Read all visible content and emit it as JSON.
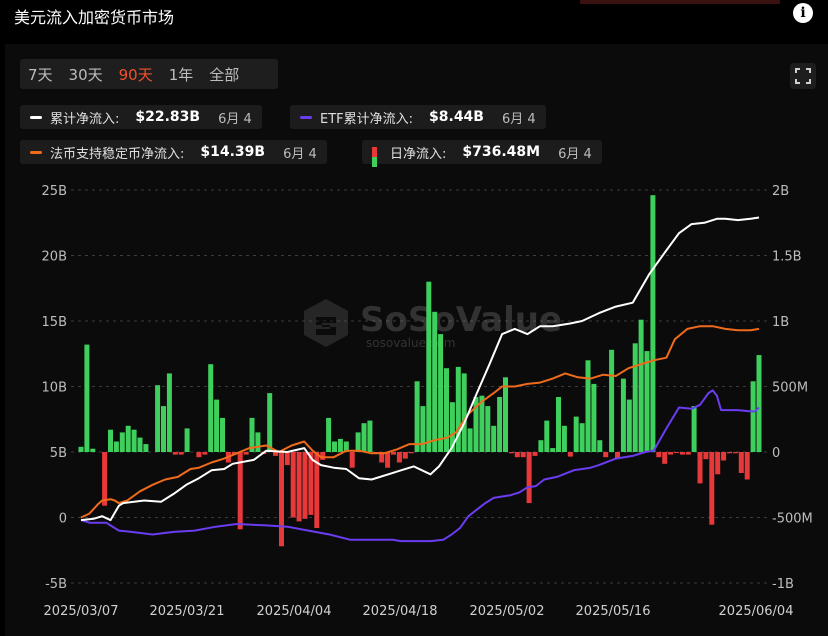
{
  "header": {
    "title": "美元流入加密货币市场",
    "info_icon": "i"
  },
  "tabs": [
    {
      "label": "7天",
      "active": false
    },
    {
      "label": "30天",
      "active": false
    },
    {
      "label": "90天",
      "active": true
    },
    {
      "label": "1年",
      "active": false
    },
    {
      "label": "全部",
      "active": false
    }
  ],
  "legend": [
    {
      "name": "累计净流入:",
      "value": "$22.83B",
      "date": "6月 4",
      "color": "#ffffff",
      "kind": "line"
    },
    {
      "name": "ETF累计净流入:",
      "value": "$8.44B",
      "date": "6月 4",
      "color": "#6a3df0",
      "kind": "line"
    },
    {
      "name": "法币支持稳定币净流入:",
      "value": "$14.39B",
      "date": "6月 4",
      "color": "#f06a1c",
      "kind": "line"
    },
    {
      "name": "日净流入:",
      "value": "$736.48M",
      "date": "6月 4",
      "color_pos": "#3fcf5c",
      "color_neg": "#e8393a",
      "kind": "bar"
    }
  ],
  "watermark": {
    "brand": "SoSoValue",
    "url": "sosovalue.com"
  },
  "colors": {
    "white": "#ffffff",
    "etf": "#6a3df0",
    "stable": "#f06a1c",
    "pos": "#3fcf5c",
    "neg": "#e8393a",
    "grid": "#3c3c3c"
  },
  "chart_data": {
    "type": "bar",
    "title": "美元流入加密货币市场",
    "x_ticks": [
      "2025/03/07",
      "2025/03/21",
      "2025/04/04",
      "2025/04/18",
      "2025/05/02",
      "2025/05/16",
      "2025/06/04"
    ],
    "y_left": {
      "ticks": [
        "-5B",
        "0",
        "5B",
        "10B",
        "15B",
        "20B",
        "25B"
      ],
      "range": [
        -5,
        25
      ],
      "unit": "B"
    },
    "y_right": {
      "ticks": [
        "-1B",
        "-500M",
        "0",
        "500M",
        "1B",
        "1.5B",
        "2B"
      ],
      "range": [
        -1000,
        2000
      ],
      "unit": "M"
    },
    "grid": true,
    "series": [
      {
        "name": "日净流入",
        "axis": "right",
        "type": "bar",
        "values": [
          40,
          820,
          25,
          0,
          -410,
          170,
          80,
          150,
          200,
          170,
          110,
          60,
          0,
          510,
          350,
          600,
          -20,
          -20,
          180,
          0,
          -40,
          -20,
          670,
          400,
          260,
          -80,
          -20,
          -590,
          -20,
          260,
          150,
          -15,
          450,
          -30,
          -720,
          -100,
          -500,
          -530,
          -510,
          -480,
          -580,
          -60,
          260,
          80,
          100,
          80,
          -120,
          150,
          220,
          240,
          -10,
          -80,
          -120,
          -20,
          -80,
          -50,
          -10,
          540,
          350,
          1300,
          1070,
          900,
          640,
          380,
          650,
          600,
          180,
          420,
          430,
          350,
          200,
          420,
          570,
          -10,
          -40,
          -40,
          -390,
          -30,
          90,
          240,
          30,
          420,
          200,
          -35,
          270,
          220,
          700,
          520,
          90,
          -40,
          780,
          -50,
          560,
          400,
          830,
          1010,
          770,
          1960,
          -40,
          -90,
          -20,
          -5,
          -20,
          -20,
          350,
          -240,
          -55,
          -555,
          -170,
          -65,
          -10,
          -10,
          -160,
          -210,
          540,
          740
        ]
      },
      {
        "name": "累计净流入",
        "axis": "left",
        "type": "line",
        "points": [
          [
            0,
            -0.2
          ],
          [
            3,
            -0.1
          ],
          [
            5,
            0.1
          ],
          [
            7,
            -0.2
          ],
          [
            9,
            0.9
          ],
          [
            10,
            1.1
          ],
          [
            15,
            1.3
          ],
          [
            19,
            1.2
          ],
          [
            22,
            1.8
          ],
          [
            25,
            2.5
          ],
          [
            28,
            3.0
          ],
          [
            31,
            3.6
          ],
          [
            34,
            3.7
          ],
          [
            36,
            4.1
          ],
          [
            41,
            4.4
          ],
          [
            44,
            5.1
          ],
          [
            49,
            5.0
          ],
          [
            53,
            5.3
          ],
          [
            55,
            4.4
          ],
          [
            57,
            4.0
          ],
          [
            60,
            3.8
          ],
          [
            63,
            3.7
          ],
          [
            66,
            3.0
          ],
          [
            69,
            2.9
          ],
          [
            73,
            3.3
          ],
          [
            76,
            3.6
          ],
          [
            79,
            3.9
          ],
          [
            83,
            3.3
          ],
          [
            85,
            3.9
          ],
          [
            88,
            5.3
          ],
          [
            91,
            7.2
          ],
          [
            94,
            9.5
          ],
          [
            97,
            11.7
          ],
          [
            100,
            14.0
          ],
          [
            103,
            14.4
          ],
          [
            106,
            14.0
          ],
          [
            109,
            14.6
          ],
          [
            112,
            14.6
          ],
          [
            116,
            14.8
          ],
          [
            119,
            15.0
          ],
          [
            123,
            15.6
          ],
          [
            127,
            16.1
          ],
          [
            131,
            16.4
          ],
          [
            135,
            18.6
          ],
          [
            139,
            20.4
          ],
          [
            142,
            21.7
          ],
          [
            145,
            22.4
          ],
          [
            148,
            22.5
          ],
          [
            151,
            22.8
          ],
          [
            153,
            22.8
          ],
          [
            156,
            22.7
          ],
          [
            159,
            22.8
          ],
          [
            161,
            22.9
          ]
        ]
      },
      {
        "name": "ETF累计净流入",
        "axis": "left",
        "type": "line",
        "points": [
          [
            0,
            -0.2
          ],
          [
            2,
            -0.4
          ],
          [
            6,
            -0.4
          ],
          [
            7,
            -0.6
          ],
          [
            9,
            -1.0
          ],
          [
            12,
            -1.1
          ],
          [
            17,
            -1.3
          ],
          [
            22,
            -1.1
          ],
          [
            27,
            -1.0
          ],
          [
            32,
            -0.7
          ],
          [
            37,
            -0.5
          ],
          [
            44,
            -0.6
          ],
          [
            49,
            -0.7
          ],
          [
            54,
            -1.0
          ],
          [
            59,
            -1.3
          ],
          [
            64,
            -1.7
          ],
          [
            69,
            -1.7
          ],
          [
            74,
            -1.7
          ],
          [
            76,
            -1.8
          ],
          [
            79,
            -1.8
          ],
          [
            83,
            -1.8
          ],
          [
            86,
            -1.7
          ],
          [
            88,
            -1.3
          ],
          [
            90,
            -0.8
          ],
          [
            92,
            0.1
          ],
          [
            94,
            0.6
          ],
          [
            96,
            1.1
          ],
          [
            98,
            1.5
          ],
          [
            100,
            1.6
          ],
          [
            102,
            1.7
          ],
          [
            104,
            1.9
          ],
          [
            106,
            2.3
          ],
          [
            108,
            2.4
          ],
          [
            110,
            2.9
          ],
          [
            113,
            3.1
          ],
          [
            117,
            3.6
          ],
          [
            121,
            3.8
          ],
          [
            123,
            4.0
          ],
          [
            127,
            4.5
          ],
          [
            131,
            4.7
          ],
          [
            134,
            5.0
          ],
          [
            136,
            5.1
          ],
          [
            139,
            6.8
          ],
          [
            142,
            8.4
          ],
          [
            145,
            8.3
          ],
          [
            147,
            8.6
          ],
          [
            149,
            9.5
          ],
          [
            150,
            9.7
          ],
          [
            151,
            9.3
          ],
          [
            152,
            8.2
          ],
          [
            156,
            8.2
          ],
          [
            159,
            8.1
          ],
          [
            160,
            8.1
          ],
          [
            161,
            8.4
          ]
        ]
      },
      {
        "name": "法币支持稳定币净流入",
        "axis": "left",
        "type": "line",
        "points": [
          [
            0,
            0
          ],
          [
            2,
            0.3
          ],
          [
            4,
            1.0
          ],
          [
            5,
            1.3
          ],
          [
            7,
            1.4
          ],
          [
            8,
            1.3
          ],
          [
            9,
            1.1
          ],
          [
            11,
            1.3
          ],
          [
            14,
            2.0
          ],
          [
            17,
            2.5
          ],
          [
            20,
            2.9
          ],
          [
            23,
            3.1
          ],
          [
            26,
            3.7
          ],
          [
            28,
            3.8
          ],
          [
            31,
            4.2
          ],
          [
            34,
            4.5
          ],
          [
            37,
            4.9
          ],
          [
            40,
            5.3
          ],
          [
            44,
            5.5
          ],
          [
            47,
            5.0
          ],
          [
            50,
            5.5
          ],
          [
            53,
            5.8
          ],
          [
            55,
            5.1
          ],
          [
            57,
            4.6
          ],
          [
            60,
            4.6
          ],
          [
            63,
            5.1
          ],
          [
            66,
            5.1
          ],
          [
            69,
            4.9
          ],
          [
            72,
            4.9
          ],
          [
            75,
            5.2
          ],
          [
            78,
            5.6
          ],
          [
            81,
            5.6
          ],
          [
            84,
            5.9
          ],
          [
            87,
            6.1
          ],
          [
            89,
            6.5
          ],
          [
            92,
            7.9
          ],
          [
            95,
            8.8
          ],
          [
            98,
            9.5
          ],
          [
            100,
            10.0
          ],
          [
            103,
            10.0
          ],
          [
            106,
            10.2
          ],
          [
            109,
            10.3
          ],
          [
            112,
            10.6
          ],
          [
            115,
            11.0
          ],
          [
            118,
            10.7
          ],
          [
            121,
            10.6
          ],
          [
            124,
            10.9
          ],
          [
            127,
            10.8
          ],
          [
            130,
            11.4
          ],
          [
            133,
            11.7
          ],
          [
            136,
            12.0
          ],
          [
            139,
            12.2
          ],
          [
            141,
            13.6
          ],
          [
            144,
            14.4
          ],
          [
            147,
            14.6
          ],
          [
            150,
            14.6
          ],
          [
            153,
            14.4
          ],
          [
            156,
            14.3
          ],
          [
            159,
            14.3
          ],
          [
            161,
            14.4
          ]
        ]
      }
    ]
  }
}
